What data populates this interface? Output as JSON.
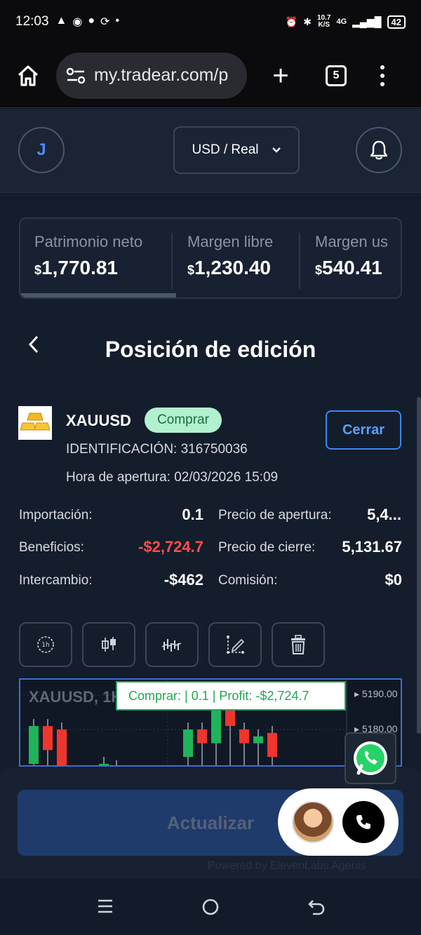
{
  "status_bar": {
    "time": "12:03",
    "net_speed_top": "10.7",
    "net_speed_bottom": "K/S",
    "network": "4G",
    "battery": "42"
  },
  "browser": {
    "url": "my.tradear.com/p",
    "tab_count": "5"
  },
  "header": {
    "avatar_initial": "J",
    "account": "USD / Real"
  },
  "stats": [
    {
      "label": "Patrimonio neto",
      "currency": "$",
      "value": "1,770.81"
    },
    {
      "label": "Margen libre",
      "currency": "$",
      "value": "1,230.40"
    },
    {
      "label": "Margen us",
      "currency": "$",
      "value": "540.41"
    }
  ],
  "page_title": "Posición de edición",
  "position": {
    "symbol": "XAUUSD",
    "side": "Comprar",
    "close_label": "Cerrar",
    "id_line": "IDENTIFICACIÓN: 316750036",
    "open_time_line": "Hora de apertura: 02/03/2026 15:09"
  },
  "details": {
    "import_label": "Importación:",
    "import_value": "0.1",
    "profit_label": "Beneficios:",
    "profit_value": "-$2,724.7",
    "swap_label": "Intercambio:",
    "swap_value": "-$462",
    "open_price_label": "Precio de apertura:",
    "open_price_value": "5,4...",
    "close_price_label": "Precio de cierre:",
    "close_price_value": "5,131.67",
    "commission_label": "Comisión:",
    "commission_value": "$0"
  },
  "tools": [
    {
      "icon": "timeframe-icon",
      "glyph": "1h"
    },
    {
      "icon": "candle-type-icon"
    },
    {
      "icon": "indicators-icon"
    },
    {
      "icon": "drawing-icon"
    },
    {
      "icon": "trash-icon"
    }
  ],
  "chart": {
    "title": "XAUUSD, 1H",
    "tooltip": "Comprar: | 0.1    | Profit:  -$2,724.7",
    "price_labels": [
      "5190.00",
      "5180.00"
    ],
    "colors": {
      "up": "#1fb45a",
      "down": "#f0352e",
      "border": "#3c6fd0"
    }
  },
  "chart_data": {
    "type": "candlestick",
    "title": "XAUUSD, 1H",
    "y_ticks": [
      5190.0,
      5180.0
    ],
    "candles": [
      {
        "dir": "up",
        "open": 5170,
        "close": 5181
      },
      {
        "dir": "down",
        "open": 5181,
        "close": 5174
      },
      {
        "dir": "down",
        "open": 5180,
        "close": 5169
      },
      {
        "dir": "up",
        "open": 5168,
        "close": 5170
      },
      {
        "dir": "up",
        "open": 5167,
        "close": 5169
      },
      {
        "dir": "up",
        "open": 5172,
        "close": 5180
      },
      {
        "dir": "down",
        "open": 5180,
        "close": 5176
      },
      {
        "dir": "up",
        "open": 5176,
        "close": 5186
      },
      {
        "dir": "down",
        "open": 5186,
        "close": 5181
      },
      {
        "dir": "down",
        "open": 5180,
        "close": 5176
      },
      {
        "dir": "up",
        "open": 5176,
        "close": 5178
      },
      {
        "dir": "down",
        "open": 5179,
        "close": 5172
      }
    ]
  },
  "footer": {
    "update_label": "Actualizar",
    "powered_by": "Powered by ElevenLabs Agents"
  }
}
